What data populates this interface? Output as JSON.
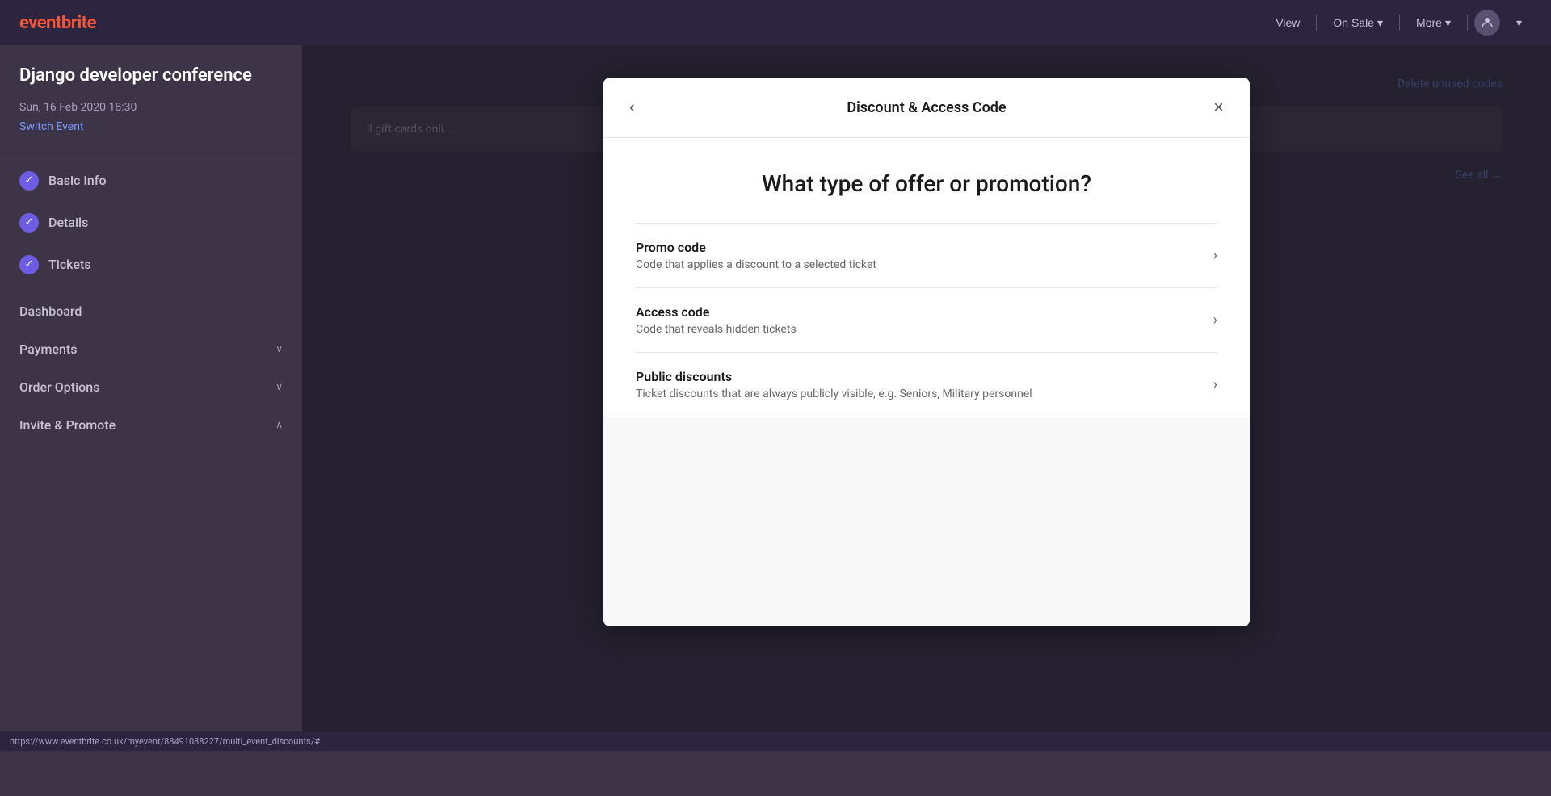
{
  "app": {
    "logo": "eventbrite"
  },
  "topnav": {
    "view_label": "View",
    "status_label": "On Sale",
    "more_label": "More",
    "chevron_down": "▾",
    "dropdown_arrow": "▾"
  },
  "sidebar": {
    "event_title": "Django developer conference",
    "event_date": "Sun, 16 Feb 2020 18:30",
    "switch_event_label": "Switch Event",
    "items": [
      {
        "label": "Basic Info",
        "checked": true
      },
      {
        "label": "Details",
        "checked": true
      },
      {
        "label": "Tickets",
        "checked": true
      }
    ],
    "sections": [
      {
        "label": "Dashboard",
        "has_chevron": false
      },
      {
        "label": "Payments",
        "has_chevron": true
      },
      {
        "label": "Order Options",
        "has_chevron": true
      },
      {
        "label": "Invite & Promote",
        "has_chevron": true
      }
    ]
  },
  "main": {
    "delete_unused_label": "Delete unused codes",
    "see_all_label": "See all →",
    "card_text": "ll gift cards onli..."
  },
  "modal": {
    "title": "Discount & Access Code",
    "question": "What type of offer or promotion?",
    "back_icon": "‹",
    "close_icon": "×",
    "options": [
      {
        "title": "Promo code",
        "description": "Code that applies a discount to a selected ticket",
        "chevron": "›"
      },
      {
        "title": "Access code",
        "description": "Code that reveals hidden tickets",
        "chevron": "›"
      },
      {
        "title": "Public discounts",
        "description": "Ticket discounts that are always publicly visible, e.g. Seniors, Military personnel",
        "chevron": "›"
      }
    ]
  },
  "statusbar": {
    "url": "https://www.eventbrite.co.uk/myevent/88491088227/multi_event_discounts/#"
  }
}
